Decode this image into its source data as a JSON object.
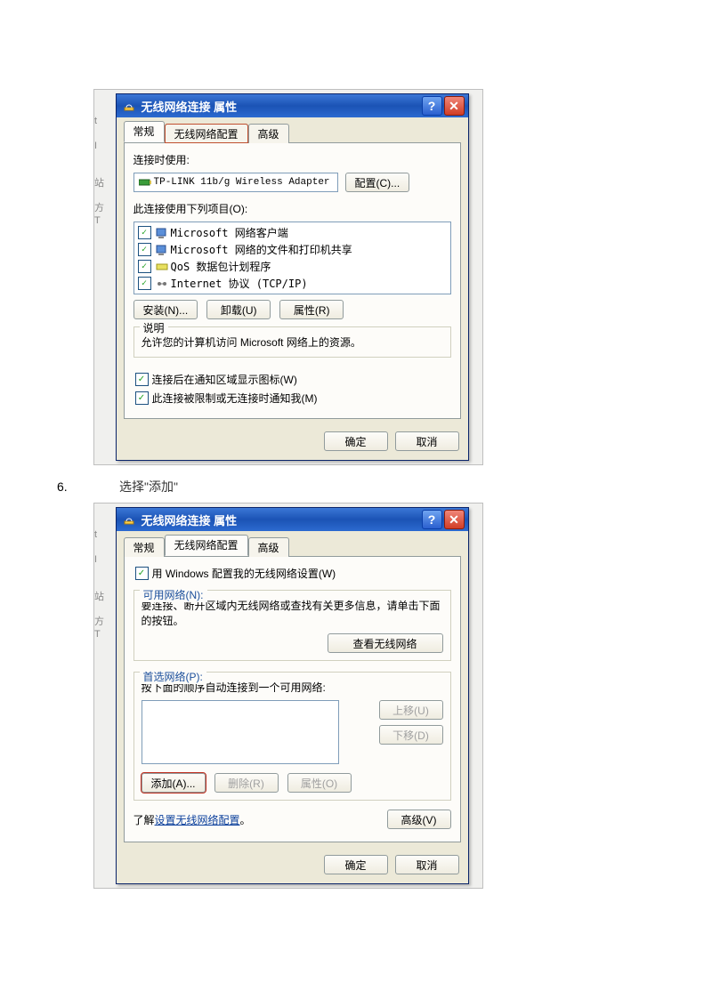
{
  "dialog1": {
    "title": "无线网络连接  属性",
    "tabs": {
      "general": "常规",
      "wireless": "无线网络配置",
      "advanced": "高级"
    },
    "connect_using_label": "连接时使用:",
    "adapter": "TP-LINK 11b/g Wireless Adapter",
    "configure_btn": "配置(C)...",
    "items_label": "此连接使用下列项目(O):",
    "items": [
      "Microsoft 网络客户端",
      "Microsoft 网络的文件和打印机共享",
      "QoS 数据包计划程序",
      "Internet 协议 (TCP/IP)"
    ],
    "install_btn": "安装(N)...",
    "uninstall_btn": "卸载(U)",
    "properties_btn": "属性(R)",
    "desc_title": "说明",
    "desc_text": "允许您的计算机访问 Microsoft 网络上的资源。",
    "show_icon": "连接后在通知区域显示图标(W)",
    "limited_notify": "此连接被限制或无连接时通知我(M)",
    "ok": "确定",
    "cancel": "取消"
  },
  "step6": {
    "num": "6.",
    "text": "选择\"添加\""
  },
  "dialog2": {
    "title": "无线网络连接  属性",
    "tabs": {
      "general": "常规",
      "wireless": "无线网络配置",
      "advanced": "高级"
    },
    "use_windows": "用 Windows 配置我的无线网络设置(W)",
    "avail_title": "可用网络(N):",
    "avail_text": "要连接、断开区域内无线网络或查找有关更多信息，请单击下面的按钮。",
    "view_btn": "查看无线网络",
    "pref_title": "首选网络(P):",
    "pref_text": "按下面的顺序自动连接到一个可用网络:",
    "move_up": "上移(U)",
    "move_down": "下移(D)",
    "add_btn": "添加(A)...",
    "remove_btn": "删除(R)",
    "properties_btn": "属性(O)",
    "learn_prefix": "了解",
    "learn_link": "设置无线网络配置",
    "learn_suffix": "。",
    "adv_btn": "高级(V)",
    "ok": "确定",
    "cancel": "取消"
  }
}
